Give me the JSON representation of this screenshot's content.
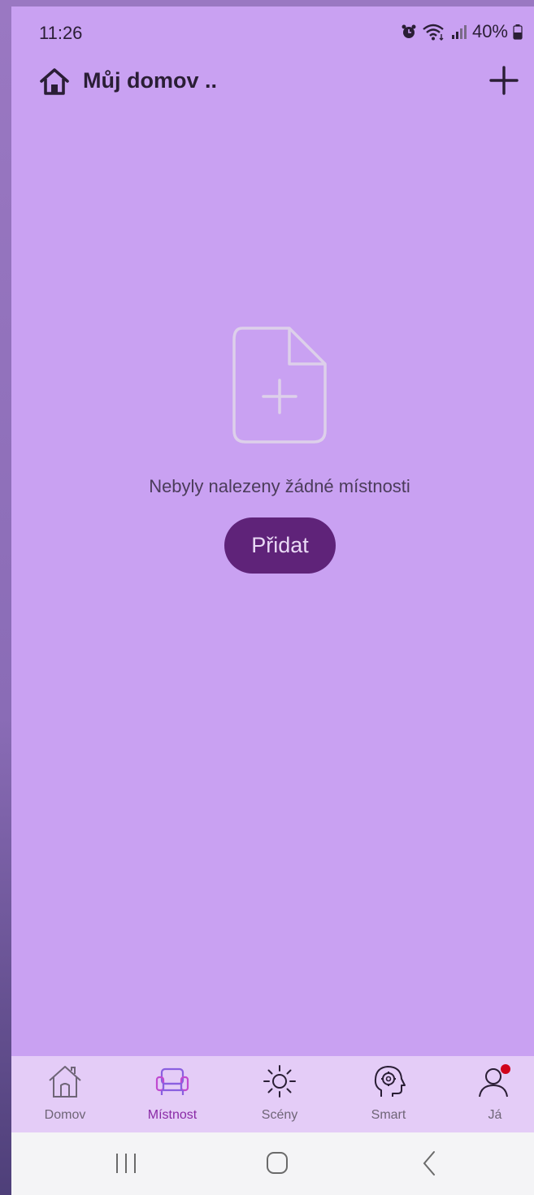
{
  "status_bar": {
    "time": "11:26",
    "battery": "40%",
    "icons": [
      "alarm-icon",
      "wifi-icon",
      "signal-icon",
      "battery-icon"
    ]
  },
  "header": {
    "title": "Můj domov ..",
    "home_icon": "home-icon",
    "add_icon": "plus-icon"
  },
  "empty_state": {
    "icon": "add-document-icon",
    "message": "Nebyly nalezeny žádné místnosti",
    "button_label": "Přidat"
  },
  "bottom_nav": {
    "items": [
      {
        "label": "Domov",
        "icon": "house-icon",
        "active": false
      },
      {
        "label": "Místnost",
        "icon": "armchair-icon",
        "active": true
      },
      {
        "label": "Scény",
        "icon": "sun-icon",
        "active": false
      },
      {
        "label": "Smart",
        "icon": "head-gear-icon",
        "active": false
      },
      {
        "label": "Já",
        "icon": "user-icon",
        "active": false,
        "badge": true
      }
    ],
    "active_color": "#8a2aa6"
  },
  "system_nav": {
    "buttons": [
      "recents-button",
      "home-button",
      "back-button"
    ]
  },
  "colors": {
    "background": "#c9a1f2",
    "button": "#5f2379",
    "nav_background": "#e4ccf7",
    "badge": "#d0021b"
  }
}
